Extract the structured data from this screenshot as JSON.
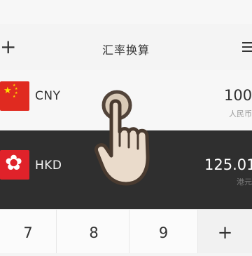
{
  "header": {
    "title": "汇率换算",
    "add_icon": "plus-icon",
    "menu_icon": "menu-icon"
  },
  "rows": [
    {
      "code": "CNY",
      "amount": "100",
      "sub_label": "人民币",
      "flag_icon": "china-flag-icon"
    },
    {
      "code": "HKD",
      "amount": "125.01",
      "sub_label": "港元",
      "flag_icon": "hong-kong-flag-icon"
    }
  ],
  "keypad": {
    "k7": "7",
    "k8": "8",
    "k9": "9",
    "plus": "+"
  },
  "colors": {
    "selected_row_bg": "#2f2f2f",
    "flag_red": "#e02a20",
    "star_yellow": "#ffde00"
  },
  "overlay": {
    "icon": "tap-gesture-hand-icon"
  }
}
